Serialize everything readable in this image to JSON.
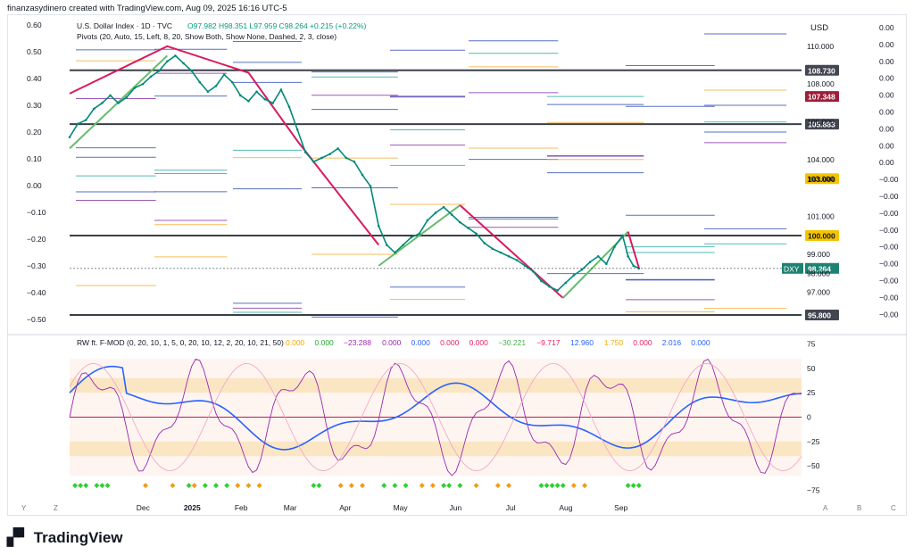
{
  "header": {
    "created_by": "finanzasydinero created with TradingView.com, Aug 09, 2025 16:16 UTC-5",
    "symbol_line": "U.S. Dollar Index · 1D · TVC",
    "ohlc": "O97.982 H98.351 L97.959 C98.264 +0.215 (+0.22%)",
    "pivots_line": "Pivots (20, Auto, 15, Left, 8, 20, Show Both, Show None, Dashed, 2, 3, close)",
    "currency": "USD",
    "ticker_badge": "DXY",
    "last_price": "98.264"
  },
  "indicator": {
    "title": "RW ft. F-MOD (0, 20, 10, 1, 5, 0, 20, 10, 12, 2, 20, 10, 21, 50)",
    "values": [
      {
        "text": "0.000",
        "color": "#f2a900"
      },
      {
        "text": "0.000",
        "color": "#22ab32"
      },
      {
        "text": "−23.288",
        "color": "#9c27b0"
      },
      {
        "text": "0.000",
        "color": "#9c27b0"
      },
      {
        "text": "0.000",
        "color": "#2962ff"
      },
      {
        "text": "0.000",
        "color": "#e91e63"
      },
      {
        "text": "0.000",
        "color": "#e91e63"
      },
      {
        "text": "−30.221",
        "color": "#4caf50"
      },
      {
        "text": "−9.717",
        "color": "#e91e63"
      },
      {
        "text": "12.960",
        "color": "#2962ff"
      },
      {
        "text": "1.750",
        "color": "#f2a900"
      },
      {
        "text": "0.000",
        "color": "#e91e63"
      },
      {
        "text": "2.016",
        "color": "#2962ff"
      },
      {
        "text": "0.000",
        "color": "#2962ff"
      }
    ],
    "axis_ticks": [
      "75",
      "50",
      "25",
      "0",
      "−25",
      "−50",
      "−75"
    ]
  },
  "brand": {
    "name": "TradingView"
  },
  "colors": {
    "price_line": "#00897b",
    "diag_red": "#d81b60",
    "diag_green": "#66bb6a",
    "pivot_blue": "#1e40af",
    "pivot_orange": "#f5a623",
    "pivot_purple": "#7b1fa2",
    "pivot_gray": "#3c3f46",
    "fast_blue": "#2962ff",
    "osc_green": "#2e7d32",
    "osc_red": "#e53935"
  },
  "chart_data": {
    "type": "line",
    "title": "U.S. Dollar Index · 1D · TVC",
    "x_months": [
      "Dec",
      "2025",
      "Feb",
      "Mar",
      "Apr",
      "May",
      "Jun",
      "Jul",
      "Aug",
      "Sep"
    ],
    "bottom_left_labels": [
      "Y",
      "Z"
    ],
    "bottom_right_labels": [
      "A",
      "B",
      "C"
    ],
    "right_axis": [
      "110.000",
      "108.000",
      "106.000",
      "104.000",
      "103.000",
      "101.000",
      "99.000",
      "98.000",
      "97.000"
    ],
    "left_axis": [
      "0.60",
      "0.50",
      "0.40",
      "0.30",
      "0.20",
      "0.10",
      "0.00",
      "−0.10",
      "−0.20",
      "−0.30",
      "−0.40",
      "−0.50"
    ],
    "far_right_axis": [
      "0.00",
      "0.00",
      "0.00",
      "0.00",
      "0.00",
      "0.00",
      "0.00",
      "0.00",
      "0.00",
      "−0.00",
      "−0.00",
      "−0.00",
      "−0.00",
      "−0.00",
      "−0.00",
      "−0.00",
      "−0.00",
      "−0.00"
    ],
    "price_badges": [
      {
        "text": "108.730",
        "color": "#434651",
        "y": 108.73
      },
      {
        "text": "107.348",
        "color": "#9c1f3a",
        "y": 107.348
      },
      {
        "text": "105.883",
        "color": "#434651",
        "y": 105.883
      },
      {
        "text": "103.000",
        "color": "#f5c400",
        "y": 103.0
      },
      {
        "text": "100.000",
        "color": "#f5c400",
        "y": 100.0
      },
      {
        "text": "95.800",
        "color": "#434651",
        "y": 95.8
      }
    ],
    "horizontal_levels": [
      108.73,
      105.883,
      100.0,
      95.8
    ],
    "series": [
      {
        "name": "DXY",
        "values": [
          [
            0,
            105.2
          ],
          [
            3,
            105.9
          ],
          [
            6,
            106.1
          ],
          [
            9,
            106.7
          ],
          [
            12,
            107.0
          ],
          [
            15,
            107.4
          ],
          [
            18,
            107.0
          ],
          [
            21,
            107.3
          ],
          [
            24,
            107.8
          ],
          [
            27,
            108.0
          ],
          [
            30,
            108.4
          ],
          [
            33,
            108.7
          ],
          [
            36,
            109.2
          ],
          [
            39,
            109.5
          ],
          [
            42,
            109.1
          ],
          [
            45,
            108.7
          ],
          [
            48,
            108.1
          ],
          [
            51,
            107.6
          ],
          [
            54,
            107.9
          ],
          [
            57,
            108.5
          ],
          [
            60,
            108.1
          ],
          [
            63,
            107.4
          ],
          [
            66,
            107.1
          ],
          [
            69,
            107.6
          ],
          [
            72,
            107.2
          ],
          [
            75,
            107.0
          ],
          [
            78,
            107.7
          ],
          [
            81,
            106.8
          ],
          [
            84,
            105.6
          ],
          [
            87,
            104.4
          ],
          [
            90,
            103.9
          ],
          [
            93,
            104.1
          ],
          [
            96,
            104.3
          ],
          [
            99,
            104.6
          ],
          [
            102,
            104.1
          ],
          [
            105,
            103.9
          ],
          [
            108,
            103.2
          ],
          [
            111,
            102.6
          ],
          [
            114,
            100.5
          ],
          [
            117,
            99.5
          ],
          [
            120,
            99.1
          ],
          [
            123,
            99.5
          ],
          [
            126,
            99.9
          ],
          [
            129,
            100.1
          ],
          [
            132,
            100.8
          ],
          [
            135,
            101.2
          ],
          [
            138,
            101.5
          ],
          [
            141,
            101.1
          ],
          [
            144,
            100.7
          ],
          [
            147,
            100.4
          ],
          [
            150,
            100.1
          ],
          [
            153,
            99.6
          ],
          [
            156,
            99.3
          ],
          [
            159,
            99.1
          ],
          [
            162,
            98.9
          ],
          [
            165,
            98.7
          ],
          [
            168,
            98.4
          ],
          [
            171,
            98.1
          ],
          [
            174,
            97.6
          ],
          [
            177,
            97.3
          ],
          [
            180,
            97.1
          ],
          [
            183,
            97.5
          ],
          [
            186,
            97.9
          ],
          [
            189,
            98.2
          ],
          [
            192,
            98.6
          ],
          [
            195,
            98.9
          ],
          [
            198,
            98.5
          ],
          [
            201,
            99.4
          ],
          [
            204,
            100.0
          ],
          [
            206,
            98.9
          ],
          [
            208,
            98.4
          ],
          [
            210,
            98.264
          ]
        ]
      }
    ]
  }
}
